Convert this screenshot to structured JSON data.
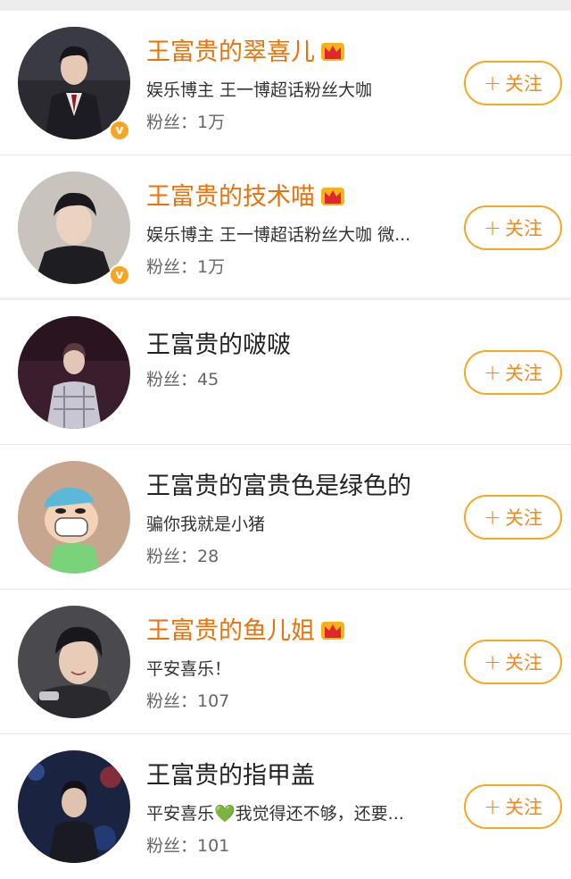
{
  "users": [
    {
      "name": "王富贵的翠喜儿",
      "vip": true,
      "verified": true,
      "desc": "娱乐博主 王一博超话粉丝大咖",
      "fans": "粉丝：1万",
      "follow": "关注",
      "avatar": "avatar-suit-man"
    },
    {
      "name": "王富贵的技术喵",
      "vip": true,
      "verified": true,
      "desc": "娱乐博主 王一博超话粉丝大咖 微...",
      "fans": "粉丝：1万",
      "follow": "关注",
      "avatar": "avatar-black-hoodie"
    },
    {
      "name": "王富贵的啵啵",
      "vip": false,
      "verified": false,
      "desc": "",
      "fans": "粉丝：45",
      "follow": "关注",
      "avatar": "avatar-stage-plaid"
    },
    {
      "name": "王富贵的富贵色是绿色的",
      "vip": false,
      "verified": false,
      "desc": "骗你我就是小猪",
      "fans": "粉丝：28",
      "follow": "关注",
      "avatar": "avatar-cartoon-masked"
    },
    {
      "name": "王富贵的鱼儿姐",
      "vip": true,
      "verified": false,
      "desc": "平安喜乐！",
      "fans": "粉丝：107",
      "follow": "关注",
      "avatar": "avatar-smiling-man"
    },
    {
      "name": "王富贵的指甲盖",
      "vip": false,
      "verified": false,
      "desc": "平安喜乐💚我觉得还不够，还要...",
      "fans": "粉丝：101",
      "follow": "关注",
      "avatar": "avatar-stage-lights"
    }
  ],
  "colors": {
    "vip_name": "#e8730c",
    "follow_border": "#f5a623",
    "follow_text": "#f08a1c",
    "verified_badge": "#f5a623"
  }
}
